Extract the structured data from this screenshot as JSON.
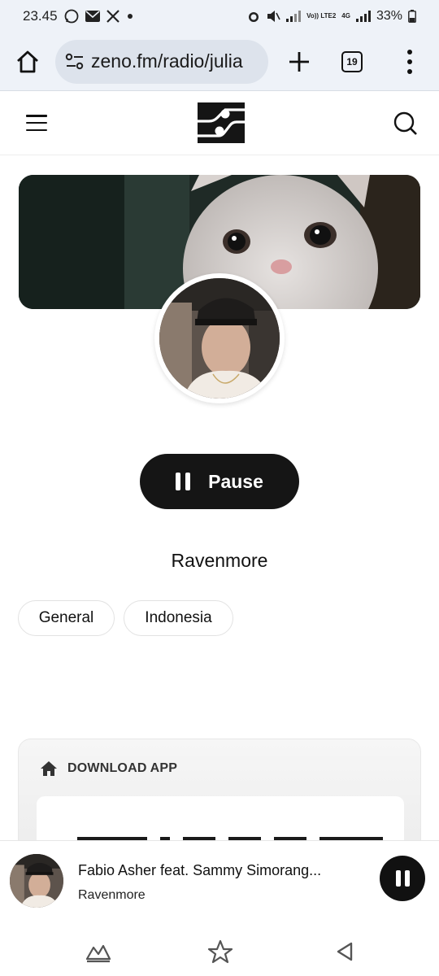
{
  "status_bar": {
    "time": "23.45",
    "left_icons": [
      "whatsapp-icon",
      "mail-icon",
      "x-icon",
      "dot-icon"
    ],
    "right_icons": [
      "alarm-icon",
      "mute-icon",
      "signal-icon",
      "volte-icon",
      "4g-icon",
      "signal-icon"
    ],
    "volte_label": "Vo)) LTE2",
    "network_label": "4G",
    "battery": "33%"
  },
  "browser": {
    "url": "zeno.fm/radio/julia",
    "tab_count": "19"
  },
  "station": {
    "pause_label": "Pause",
    "name": "Ravenmore",
    "tags": [
      "General",
      "Indonesia"
    ]
  },
  "download": {
    "title": "DOWNLOAD APP"
  },
  "player": {
    "track_title": "Fabio Asher feat. Sammy Simorang...",
    "station": "Ravenmore"
  },
  "colors": {
    "chrome_bg": "#eef2f8",
    "url_pill": "#dde3ec",
    "button_dark": "#151515"
  }
}
